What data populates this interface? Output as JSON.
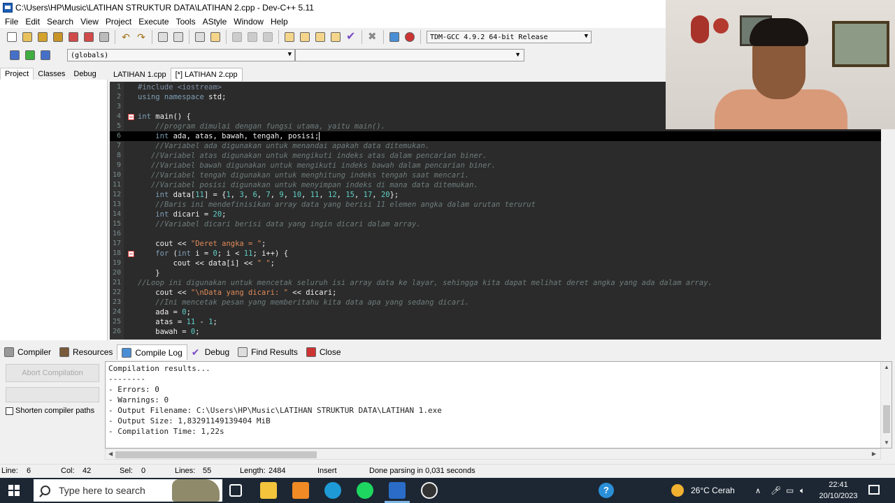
{
  "window": {
    "title": "C:\\Users\\HP\\Music\\LATIHAN STRUKTUR DATA\\LATIHAN 2.cpp - Dev-C++ 5.11"
  },
  "menu": [
    "File",
    "Edit",
    "Search",
    "View",
    "Project",
    "Execute",
    "Tools",
    "AStyle",
    "Window",
    "Help"
  ],
  "toolbar": {
    "compiler": "TDM-GCC 4.9.2 64-bit Release",
    "scope": "(globals)"
  },
  "left_tabs": [
    "Project",
    "Classes",
    "Debug"
  ],
  "editor_tabs": [
    "LATIHAN 1.cpp",
    "[*] LATIHAN 2.cpp"
  ],
  "code": [
    {
      "n": "1",
      "fold": false,
      "indent": "",
      "parts": [
        {
          "t": "#include <iostream>",
          "c": "pre"
        }
      ]
    },
    {
      "n": "2",
      "fold": false,
      "indent": "",
      "parts": [
        {
          "t": "using namespace ",
          "c": "kw"
        },
        {
          "t": "std;",
          "c": "id"
        }
      ]
    },
    {
      "n": "3",
      "fold": false,
      "indent": "",
      "parts": []
    },
    {
      "n": "4",
      "fold": true,
      "indent": "",
      "parts": [
        {
          "t": "int ",
          "c": "kw"
        },
        {
          "t": "main() {",
          "c": "id"
        }
      ]
    },
    {
      "n": "5",
      "fold": false,
      "indent": "    ",
      "parts": [
        {
          "t": "//program dimulai dengan fungsi utama, yaitu main().",
          "c": "cm"
        }
      ]
    },
    {
      "n": "6",
      "fold": false,
      "indent": "    ",
      "current": true,
      "parts": [
        {
          "t": "int ",
          "c": "kw"
        },
        {
          "t": "ada, atas, bawah, tengah, posisi;",
          "c": "id"
        }
      ]
    },
    {
      "n": "7",
      "fold": false,
      "indent": "    ",
      "parts": [
        {
          "t": "//Variabel ada digunakan untuk menandai apakah data ditemukan.",
          "c": "cm"
        }
      ]
    },
    {
      "n": "8",
      "fold": false,
      "indent": "   ",
      "parts": [
        {
          "t": "//Variabel atas digunakan untuk mengikuti indeks atas dalam pencarian biner.",
          "c": "cm"
        }
      ]
    },
    {
      "n": "9",
      "fold": false,
      "indent": "   ",
      "parts": [
        {
          "t": "//Variabel bawah digunakan untuk mengikuti indeks bawah dalam pencarian biner.",
          "c": "cm"
        }
      ]
    },
    {
      "n": "10",
      "fold": false,
      "indent": "   ",
      "parts": [
        {
          "t": "//Variabel tengah digunakan untuk menghitung indeks tengah saat mencari.",
          "c": "cm"
        }
      ]
    },
    {
      "n": "11",
      "fold": false,
      "indent": "   ",
      "parts": [
        {
          "t": "//Variabel posisi digunakan untuk menyimpan indeks di mana data ditemukan.",
          "c": "cm"
        }
      ]
    },
    {
      "n": "12",
      "fold": false,
      "indent": "    ",
      "parts": [
        {
          "t": "int ",
          "c": "kw"
        },
        {
          "t": "data[",
          "c": "id"
        },
        {
          "t": "11",
          "c": "num"
        },
        {
          "t": "] = {",
          "c": "id"
        },
        {
          "t": "1",
          "c": "num"
        },
        {
          "t": ", ",
          "c": "id"
        },
        {
          "t": "3",
          "c": "num"
        },
        {
          "t": ", ",
          "c": "id"
        },
        {
          "t": "6",
          "c": "num"
        },
        {
          "t": ", ",
          "c": "id"
        },
        {
          "t": "7",
          "c": "num"
        },
        {
          "t": ", ",
          "c": "id"
        },
        {
          "t": "9",
          "c": "num"
        },
        {
          "t": ", ",
          "c": "id"
        },
        {
          "t": "10",
          "c": "num"
        },
        {
          "t": ", ",
          "c": "id"
        },
        {
          "t": "11",
          "c": "num"
        },
        {
          "t": ", ",
          "c": "id"
        },
        {
          "t": "12",
          "c": "num"
        },
        {
          "t": ", ",
          "c": "id"
        },
        {
          "t": "15",
          "c": "num"
        },
        {
          "t": ", ",
          "c": "id"
        },
        {
          "t": "17",
          "c": "num"
        },
        {
          "t": ", ",
          "c": "id"
        },
        {
          "t": "20",
          "c": "num"
        },
        {
          "t": "};",
          "c": "id"
        }
      ]
    },
    {
      "n": "13",
      "fold": false,
      "indent": "    ",
      "parts": [
        {
          "t": "//Baris ini mendefinisikan array data yang berisi 11 elemen angka dalam urutan terurut",
          "c": "cm"
        }
      ]
    },
    {
      "n": "14",
      "fold": false,
      "indent": "    ",
      "parts": [
        {
          "t": "int ",
          "c": "kw"
        },
        {
          "t": "dicari = ",
          "c": "id"
        },
        {
          "t": "20",
          "c": "num"
        },
        {
          "t": ";",
          "c": "id"
        }
      ]
    },
    {
      "n": "15",
      "fold": false,
      "indent": "    ",
      "parts": [
        {
          "t": "//Variabel dicari berisi data yang ingin dicari dalam array.",
          "c": "cm"
        }
      ]
    },
    {
      "n": "16",
      "fold": false,
      "indent": "",
      "parts": []
    },
    {
      "n": "17",
      "fold": false,
      "indent": "    ",
      "parts": [
        {
          "t": "cout << ",
          "c": "id"
        },
        {
          "t": "\"Deret angka = \"",
          "c": "str"
        },
        {
          "t": ";",
          "c": "id"
        }
      ]
    },
    {
      "n": "18",
      "fold": true,
      "indent": "    ",
      "parts": [
        {
          "t": "for ",
          "c": "kw"
        },
        {
          "t": "(",
          "c": "id"
        },
        {
          "t": "int ",
          "c": "kw"
        },
        {
          "t": "i = ",
          "c": "id"
        },
        {
          "t": "0",
          "c": "num"
        },
        {
          "t": "; i < ",
          "c": "id"
        },
        {
          "t": "11",
          "c": "num"
        },
        {
          "t": "; i++) {",
          "c": "id"
        }
      ]
    },
    {
      "n": "19",
      "fold": false,
      "indent": "        ",
      "parts": [
        {
          "t": "cout << data[i] << ",
          "c": "id"
        },
        {
          "t": "\" \"",
          "c": "str"
        },
        {
          "t": ";",
          "c": "id"
        }
      ]
    },
    {
      "n": "20",
      "fold": false,
      "indent": "    ",
      "parts": [
        {
          "t": "}",
          "c": "id"
        }
      ]
    },
    {
      "n": "21",
      "fold": false,
      "indent": "",
      "parts": [
        {
          "t": "//Loop ini digunakan untuk mencetak seluruh isi array data ke layar, sehingga kita dapat melihat deret angka yang ada dalam array.",
          "c": "cm"
        }
      ]
    },
    {
      "n": "22",
      "fold": false,
      "indent": "    ",
      "parts": [
        {
          "t": "cout << ",
          "c": "id"
        },
        {
          "t": "\"\\nData yang dicari: \"",
          "c": "str"
        },
        {
          "t": " << dicari;",
          "c": "id"
        }
      ]
    },
    {
      "n": "23",
      "fold": false,
      "indent": "    ",
      "parts": [
        {
          "t": "//Ini mencetak pesan yang memberitahu kita data apa yang sedang dicari.",
          "c": "cm"
        }
      ]
    },
    {
      "n": "24",
      "fold": false,
      "indent": "    ",
      "parts": [
        {
          "t": "ada = ",
          "c": "id"
        },
        {
          "t": "0",
          "c": "num"
        },
        {
          "t": ";",
          "c": "id"
        }
      ]
    },
    {
      "n": "25",
      "fold": false,
      "indent": "    ",
      "parts": [
        {
          "t": "atas = ",
          "c": "id"
        },
        {
          "t": "11",
          "c": "num"
        },
        {
          "t": " - ",
          "c": "id"
        },
        {
          "t": "1",
          "c": "num"
        },
        {
          "t": ";",
          "c": "id"
        }
      ]
    },
    {
      "n": "26",
      "fold": false,
      "indent": "    ",
      "parts": [
        {
          "t": "bawah = ",
          "c": "id"
        },
        {
          "t": "0",
          "c": "num"
        },
        {
          "t": ";",
          "c": "id"
        }
      ]
    }
  ],
  "bottom_tabs": [
    "Compiler",
    "Resources",
    "Compile Log",
    "Debug",
    "Find Results",
    "Close"
  ],
  "bottom_left": {
    "abort_label": "Abort Compilation",
    "shorten_label": "Shorten compiler paths"
  },
  "log": [
    "Compilation results...",
    "--------",
    "- Errors: 0",
    "- Warnings: 0",
    "- Output Filename: C:\\Users\\HP\\Music\\LATIHAN STRUKTUR DATA\\LATIHAN 1.exe",
    "- Output Size: 1,83291149139404 MiB",
    "- Compilation Time: 1,22s"
  ],
  "status": {
    "line_label": "Line:",
    "line_value": "6",
    "col_label": "Col:",
    "col_value": "42",
    "sel_label": "Sel:",
    "sel_value": "0",
    "lines_label": "Lines:",
    "lines_value": "55",
    "length_label": "Length:",
    "length_value": "2484",
    "mode": "Insert",
    "message": "Done parsing in 0,031 seconds"
  },
  "taskbar": {
    "search_placeholder": "Type here to search",
    "weather": "26°C  Cerah",
    "time": "22:41",
    "date": "20/10/2023"
  }
}
